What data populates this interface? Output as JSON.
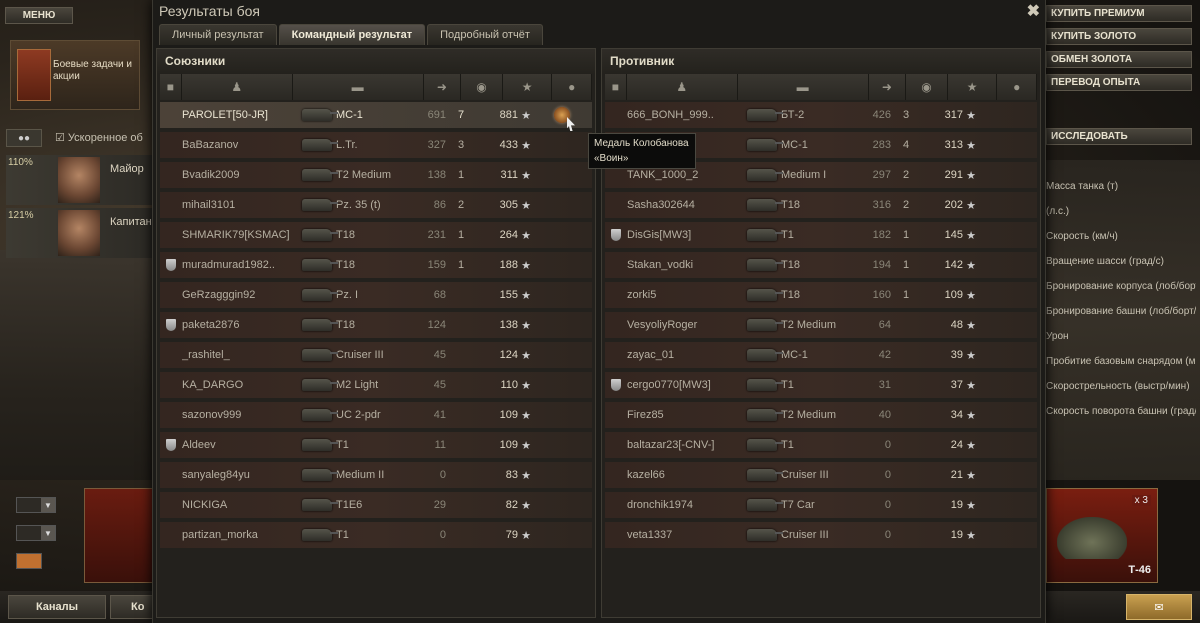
{
  "garage": {
    "menu_label": "МЕНЮ",
    "quests_label": "Боевые задачи и акции",
    "accelerated_label": "Ускоренное об",
    "crew": [
      {
        "pct": "110%",
        "rank": "Майор"
      },
      {
        "pct": "121%",
        "rank": "Капитан"
      }
    ],
    "right_buttons": [
      "КУПИТЬ ПРЕМИУМ",
      "КУПИТЬ ЗОЛОТО",
      "ОБМЕН ЗОЛОТА",
      "ПЕРЕВОД ОПЫТА"
    ],
    "research_label": "ИССЛЕДОВАТЬ",
    "stats_labels": [
      "Масса танка (т)",
      "(л.с.)",
      "Скорость (км/ч)",
      "Вращение шасси (град/с)",
      "Бронирование корпуса (лоб/борт/корма в мм)",
      "Бронирование башни (лоб/борт/корма в мм)",
      "Урон",
      "Пробитие базовым снарядом (мм)",
      "Скорострельность (выстр/мин)",
      "Скорость поворота башни (град/с)"
    ],
    "channels_label": "Каналы",
    "contacts_label": "Ко",
    "tank_name": "Т-46",
    "tank_count": "x 3"
  },
  "dialog": {
    "title": "Результаты боя",
    "tabs": [
      {
        "label": "Личный результат",
        "active": false
      },
      {
        "label": "Командный результат",
        "active": true
      },
      {
        "label": "Подробный отчёт",
        "active": false
      }
    ],
    "allies_label": "Союзники",
    "enemies_label": "Противник",
    "tooltip_line1": "Медаль Колобанова",
    "tooltip_line2": "«Воин»"
  },
  "allies": [
    {
      "name": "PAROLET[50-JR]",
      "tank": "МС-1",
      "dmg": "691",
      "kills": "7",
      "xp": "881",
      "medal": true,
      "me": true
    },
    {
      "name": "BaBazanov",
      "tank": "L.Tr.",
      "dmg": "327",
      "kills": "3",
      "xp": "433"
    },
    {
      "name": "Bvadik2009",
      "tank": "T2 Medium",
      "dmg": "138",
      "kills": "1",
      "xp": "311"
    },
    {
      "name": "mihail3101",
      "tank": "Pz. 35 (t)",
      "dmg": "86",
      "kills": "2",
      "xp": "305"
    },
    {
      "name": "SHMARIK79[KSMAC]",
      "tank": "T18",
      "dmg": "231",
      "kills": "1",
      "xp": "264"
    },
    {
      "name": "muradmurad1982..",
      "tank": "T18",
      "dmg": "159",
      "kills": "1",
      "xp": "188",
      "squad": true
    },
    {
      "name": "GeRzagggin92",
      "tank": "Pz. I",
      "dmg": "68",
      "kills": "",
      "xp": "155"
    },
    {
      "name": "paketa2876",
      "tank": "T18",
      "dmg": "124",
      "kills": "",
      "xp": "138",
      "squad": true
    },
    {
      "name": "_rashitel_",
      "tank": "Cruiser III",
      "dmg": "45",
      "kills": "",
      "xp": "124"
    },
    {
      "name": "KA_DARGO",
      "tank": "M2 Light",
      "dmg": "45",
      "kills": "",
      "xp": "110"
    },
    {
      "name": "sazonov999",
      "tank": "UC 2-pdr",
      "dmg": "41",
      "kills": "",
      "xp": "109"
    },
    {
      "name": "Aldeev",
      "tank": "T1",
      "dmg": "11",
      "kills": "",
      "xp": "109",
      "squad": true
    },
    {
      "name": "sanyaleg84yu",
      "tank": "Medium II",
      "dmg": "0",
      "kills": "",
      "xp": "83"
    },
    {
      "name": "NICKIGA",
      "tank": "T1E6",
      "dmg": "29",
      "kills": "",
      "xp": "82"
    },
    {
      "name": "partizan_morka",
      "tank": "T1",
      "dmg": "0",
      "kills": "",
      "xp": "79"
    }
  ],
  "enemies": [
    {
      "name": "666_BONH_999..",
      "tank": "БТ-2",
      "dmg": "426",
      "kills": "3",
      "xp": "317"
    },
    {
      "name": "",
      "tank": "МС-1",
      "dmg": "283",
      "kills": "4",
      "xp": "313"
    },
    {
      "name": "TANK_1000_2",
      "tank": "Medium I",
      "dmg": "297",
      "kills": "2",
      "xp": "291"
    },
    {
      "name": "Sasha302644",
      "tank": "T18",
      "dmg": "316",
      "kills": "2",
      "xp": "202"
    },
    {
      "name": "DisGis[MW3]",
      "tank": "T1",
      "dmg": "182",
      "kills": "1",
      "xp": "145",
      "squad": true
    },
    {
      "name": "Stakan_vodki",
      "tank": "T18",
      "dmg": "194",
      "kills": "1",
      "xp": "142"
    },
    {
      "name": "zorki5",
      "tank": "T18",
      "dmg": "160",
      "kills": "1",
      "xp": "109"
    },
    {
      "name": "VesyoliyRoger",
      "tank": "T2 Medium",
      "dmg": "64",
      "kills": "",
      "xp": "48"
    },
    {
      "name": "zayac_01",
      "tank": "МС-1",
      "dmg": "42",
      "kills": "",
      "xp": "39"
    },
    {
      "name": "cergo0770[MW3]",
      "tank": "T1",
      "dmg": "31",
      "kills": "",
      "xp": "37",
      "squad": true
    },
    {
      "name": "Firez85",
      "tank": "T2 Medium",
      "dmg": "40",
      "kills": "",
      "xp": "34"
    },
    {
      "name": "baltazar23[-CNV-]",
      "tank": "T1",
      "dmg": "0",
      "kills": "",
      "xp": "24"
    },
    {
      "name": "kazel66",
      "tank": "Cruiser III",
      "dmg": "0",
      "kills": "",
      "xp": "21"
    },
    {
      "name": "dronchik1974",
      "tank": "T7 Car",
      "dmg": "0",
      "kills": "",
      "xp": "19"
    },
    {
      "name": "veta1337",
      "tank": "Cruiser III",
      "dmg": "0",
      "kills": "",
      "xp": "19"
    }
  ]
}
